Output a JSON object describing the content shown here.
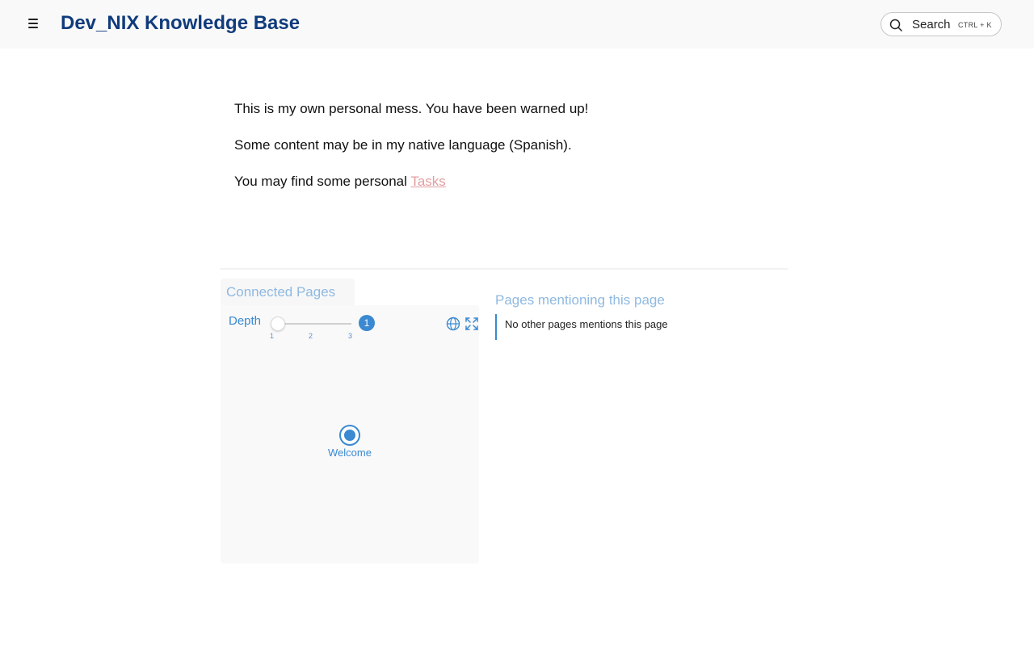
{
  "header": {
    "site_title": "Dev_NIX Knowledge Base",
    "search_label": "Search",
    "search_shortcut": "CTRL + K"
  },
  "content": {
    "line1": "This is my own personal mess. You have been warned up!",
    "line2": "Some content may be in my native language (Spanish).",
    "line3_prefix": "You may find some personal ",
    "line3_link": "Tasks"
  },
  "graph": {
    "tab_title": "Connected Pages",
    "depth_label": "Depth",
    "depth_ticks": [
      "1",
      "2",
      "3"
    ],
    "depth_value": "1",
    "node_label": "Welcome",
    "icons": [
      "menu-icon",
      "search-icon",
      "globe-icon",
      "expand-icon"
    ]
  },
  "mentions": {
    "title": "Pages mentioning this page",
    "empty_text": "No other pages mentions this page"
  },
  "colors": {
    "title": "#103b7c",
    "accent": "#3a89d1",
    "link": "#e39da0",
    "muted_heading": "#8fb9e1"
  }
}
